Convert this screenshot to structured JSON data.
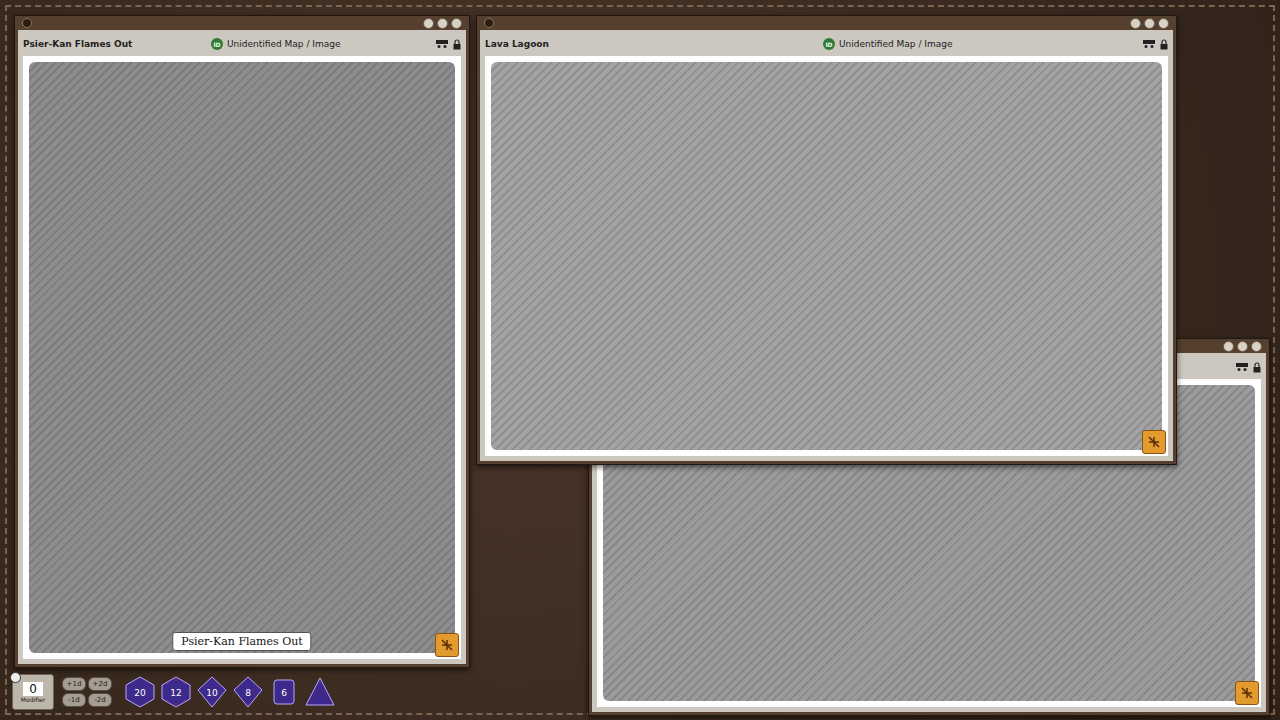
{
  "windows": [
    {
      "title": "Psier-Kan Flames Out",
      "id_badge": "ID",
      "subtitle": "Unidentified Map / Image",
      "caption": "Psier-Kan Flames Out",
      "locked": true,
      "tone": "#8d8d8d"
    },
    {
      "title": "Lava Lagoon",
      "id_badge": "ID",
      "subtitle": "Unidentified Map / Image",
      "caption": "",
      "locked": true,
      "tone": "#a3a3a3"
    }
  ],
  "background_window": {
    "locked": true,
    "tone": "#9b9b9b"
  },
  "modifier": {
    "value": "0",
    "label": "Modifier"
  },
  "dice_modifiers": [
    "+1d",
    "+2d",
    "-1d",
    "-2d"
  ],
  "dice": [
    {
      "label": "20",
      "shape": "d20"
    },
    {
      "label": "12",
      "shape": "d12"
    },
    {
      "label": "10",
      "shape": "d10"
    },
    {
      "label": "8",
      "shape": "d8"
    },
    {
      "label": "6",
      "shape": "d6"
    },
    {
      "label": "",
      "shape": "d4"
    }
  ]
}
